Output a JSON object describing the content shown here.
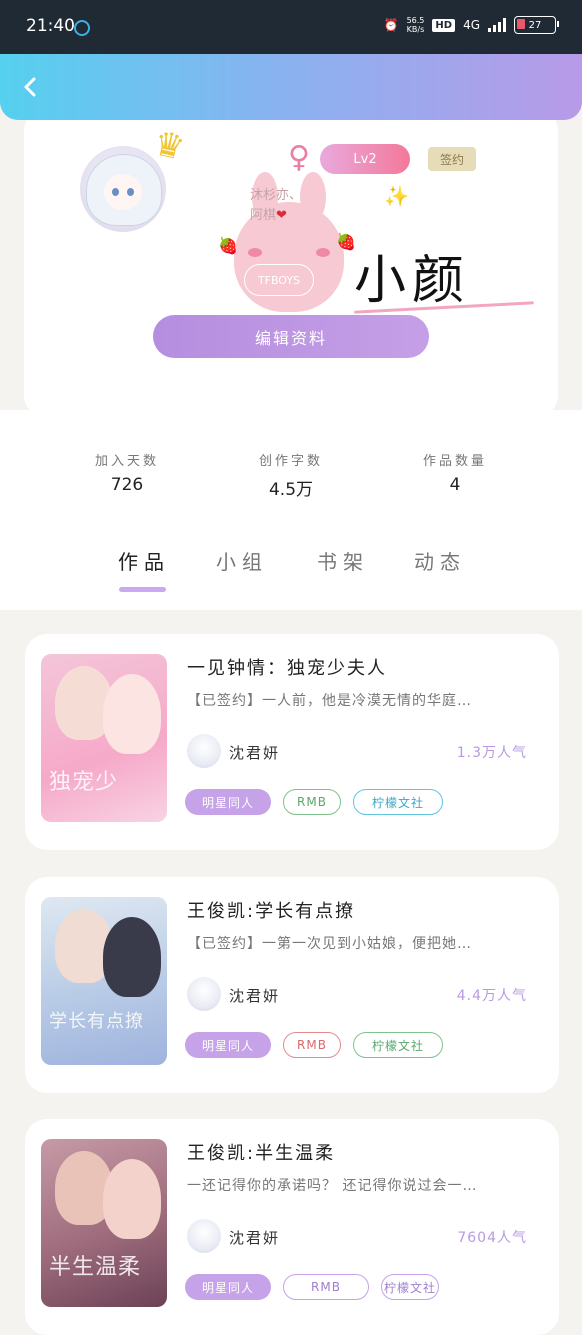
{
  "status_bar": {
    "time": "21:40",
    "speed_top": "56.5",
    "speed_bottom": "KB/s",
    "hd": "HD",
    "network": "4G",
    "battery": "27"
  },
  "profile": {
    "level": "Lv2",
    "sign_badge": "签约",
    "deco_line1": "沐杉亦、",
    "deco_line2": "阿棋",
    "deco_tag": "TFBOYS",
    "nickname": "小颜",
    "edit_button": "编辑资料"
  },
  "stats": [
    {
      "label": "加入天数",
      "value": "726"
    },
    {
      "label": "创作字数",
      "value": "4.5万"
    },
    {
      "label": "作品数量",
      "value": "4"
    }
  ],
  "tabs": [
    "作品",
    "小组",
    "书架",
    "动态"
  ],
  "books": [
    {
      "title": "一见钟情：独宠少夫人",
      "desc": "【已签约】一人前，他是冷漠无情的华庭…",
      "author": "沈君妍",
      "popularity": "1.3万人气",
      "cover_text": "独宠少",
      "tags": [
        "明星同人",
        "RMB",
        "柠檬文社"
      ]
    },
    {
      "title": "王俊凯:学长有点撩",
      "desc": "【已签约】一第一次见到小姑娘，便把她…",
      "author": "沈君妍",
      "popularity": "4.4万人气",
      "cover_text": "学长有点撩",
      "tags": [
        "明星同人",
        "RMB",
        "柠檬文社"
      ]
    },
    {
      "title": "王俊凯:半生温柔",
      "desc": "一还记得你的承诺吗？ 还记得你说过会一…",
      "author": "沈君妍",
      "popularity": "7604人气",
      "cover_text": "半生温柔",
      "tags": [
        "明星同人",
        "RMB",
        "柠檬文社"
      ]
    }
  ],
  "colors": {
    "accent": "#c6a2e8",
    "header_start": "#55d0ef",
    "header_end": "#b89ae8"
  }
}
